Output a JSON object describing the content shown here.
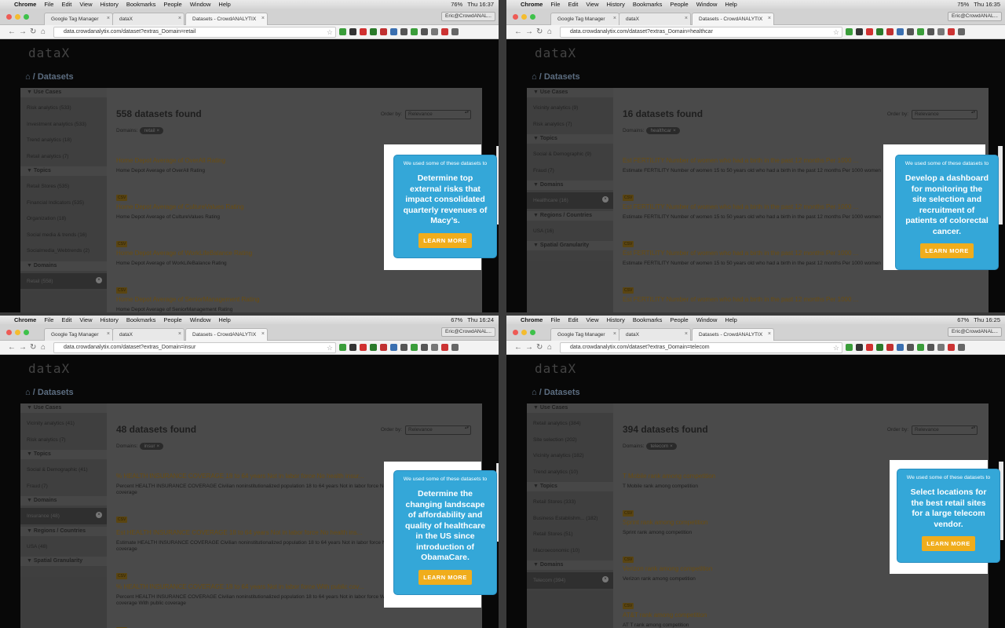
{
  "colors": {
    "card": "#34a7d8",
    "button": "#f0ad1c"
  },
  "quadrants": [
    {
      "menu": {
        "apple": "",
        "app": "Chrome",
        "items": [
          "File",
          "Edit",
          "View",
          "History",
          "Bookmarks",
          "People",
          "Window",
          "Help"
        ],
        "battery": "76%",
        "clock": "Thu 16:37"
      },
      "tabs": [
        "Google Tag Manager",
        "dataX",
        "Datasets - CrowdANALYTIX"
      ],
      "profile": "Eric@CrowdANAL...",
      "url": "data.crowdanalytix.com/dataset?extras_Domain=retail",
      "logo": "dataX",
      "breadcrumb": "/ Datasets",
      "sections": [
        {
          "title": "Use Cases",
          "items": [
            "Risk analytics (533)",
            "Investment analytics (533)",
            "Trend analytics (18)",
            "Retail analytics (7)"
          ]
        },
        {
          "title": "Topics",
          "items": [
            "Retail Stores (535)",
            "Financial Indicators (535)",
            "Organization (18)",
            "Social media & trends (16)",
            "Socialmedia_Webtrends (2)"
          ]
        },
        {
          "title": "Domains",
          "items": [
            "Retail (558)"
          ]
        }
      ],
      "found": "558 datasets found",
      "domains_label": "Domains:",
      "chip": "retail",
      "order_label": "Order by:",
      "order_value": "Relevance",
      "results": [
        {
          "title": "Home Depot Average of OverAll Rating",
          "desc": "Home Depot Average of OverAll Rating",
          "desc2": "",
          "badge": "CSV"
        },
        {
          "title": "Home Depot Average of CultureValues Rating",
          "desc": "Home Depot Average of CultureValues Rating",
          "desc2": "",
          "badge": "CSV"
        },
        {
          "title": "Home Depot Average of WorkLifeBalance Rating",
          "desc": "Home Depot Average of WorkLifeBalance Rating",
          "desc2": "",
          "badge": "CSV"
        },
        {
          "title": "Home Depot Average of SeniorManagement Rating",
          "desc": "Home Depot Average of SeniorManagement Rating",
          "desc2": "",
          "badge": ""
        }
      ],
      "card": {
        "lead": "We used some of these datasets to",
        "head": "Determine top external risks that impact consolidated quarterly revenues of Macy’s.",
        "button": "LEARN MORE"
      }
    },
    {
      "menu": {
        "apple": "",
        "app": "Chrome",
        "items": [
          "File",
          "Edit",
          "View",
          "History",
          "Bookmarks",
          "People",
          "Window",
          "Help"
        ],
        "battery": "75%",
        "clock": "Thu 16:35"
      },
      "tabs": [
        "Google Tag Manager",
        "dataX",
        "Datasets - CrowdANALYTIX"
      ],
      "profile": "Eric@CrowdANAL...",
      "url": "data.crowdanalytix.com/dataset?extras_Domain=healthcar",
      "logo": "dataX",
      "breadcrumb": "/ Datasets",
      "sections": [
        {
          "title": "Use Cases",
          "items": [
            "Vicinity analytics (9)",
            "Risk analytics (7)"
          ]
        },
        {
          "title": "Topics",
          "items": [
            "Social & Demographic (9)",
            "Fraud (7)"
          ]
        },
        {
          "title": "Domains",
          "items": [
            "Healthcare (16)"
          ]
        },
        {
          "title": "Regions / Countries",
          "items": [
            "USA (16)"
          ]
        },
        {
          "title": "Spatial Granularity",
          "items": []
        }
      ],
      "found": "16 datasets found",
      "domains_label": "Domains:",
      "chip": "healthcar",
      "order_label": "Order by:",
      "order_value": "Relevance",
      "results": [
        {
          "title": "Est FERTILITY Number of women who had a birth in the past 12 months Per 1000 ...",
          "desc": "Estimate FERTILITY Number of women 15 to 50 years old who had a birth in the past 12 months Per 1000 women",
          "desc2": "",
          "badge": "CSV"
        },
        {
          "title": "Est FERTILITY Number of women who had a birth in the past 12 months Per 1000 ...",
          "desc": "Estimate FERTILITY Number of women 15 to 50 years old who had a birth in the past 12 months Per 1000 women",
          "desc2": "",
          "badge": "CSV"
        },
        {
          "title": "Est FERTILITY Number of women who had a birth in the past 12 months Per 1000 ...",
          "desc": "Estimate FERTILITY Number of women 15 to 50 years old who had a birth in the past 12 months Per 1000 women",
          "desc2": "",
          "badge": "CSV"
        },
        {
          "title": "Est FERTILITY Number of women who had a birth in the past 12 months Per 1000 ...",
          "desc": "",
          "desc2": "",
          "badge": ""
        }
      ],
      "card": {
        "lead": "We used some of these datasets to",
        "head": "Develop a dashboard for monitoring the site selection and recruitment of patients of colorectal cancer.",
        "button": "LEARN MORE"
      }
    },
    {
      "menu": {
        "apple": "",
        "app": "Chrome",
        "items": [
          "File",
          "Edit",
          "View",
          "History",
          "Bookmarks",
          "People",
          "Window",
          "Help"
        ],
        "battery": "67%",
        "clock": "Thu 16:24"
      },
      "tabs": [
        "Google Tag Manager",
        "dataX",
        "Datasets - CrowdANALYTIX"
      ],
      "profile": "Eric@CrowdANAL...",
      "url": "data.crowdanalytix.com/dataset?extras_Domain=insur",
      "logo": "dataX",
      "breadcrumb": "/ Datasets",
      "sections": [
        {
          "title": "Use Cases",
          "items": [
            "Vicinity analytics (41)",
            "Risk analytics (7)"
          ]
        },
        {
          "title": "Topics",
          "items": [
            "Social & Demographic (41)",
            "Fraud (7)"
          ]
        },
        {
          "title": "Domains",
          "items": [
            "Insurance (48)"
          ]
        },
        {
          "title": "Regions / Countries",
          "items": [
            "USA (48)"
          ]
        },
        {
          "title": "Spatial Granularity",
          "items": []
        }
      ],
      "found": "48 datasets found",
      "domains_label": "Domains:",
      "chip": "insur",
      "order_label": "Order by:",
      "order_value": "Relevance",
      "results": [
        {
          "title": "% HEALTH INSURANCE COVERAGE 18 to 64 years Not in labor force No health insur...",
          "desc": "Percent HEALTH INSURANCE COVERAGE Civilian noninstitutionalized population 18 to 64 years Not in labor force No health insurance",
          "desc2": "coverage",
          "badge": "CSV"
        },
        {
          "title": "Est HEALTH INSURANCE COVERAGE 18 to 64 years Not in labor force No health ins...",
          "desc": "Estimate HEALTH INSURANCE COVERAGE Civilian noninstitutionalized population 18 to 64 years Not in labor force No health insurance",
          "desc2": "coverage",
          "badge": "CSV"
        },
        {
          "title": "% HEALTH INSURANCE COVERAGE 18 to 64 years Not in labor force With public cov...",
          "desc": "Percent HEALTH INSURANCE COVERAGE Civilian noninstitutionalized population 18 to 64 years Not in labor force With health insurance",
          "desc2": "coverage With public coverage",
          "badge": "CSV"
        }
      ],
      "card": {
        "lead": "We used some of these datasets to",
        "head": "Determine the changing landscape of affordability and quality of healthcare in the US since introduction of ObamaCare.",
        "button": "LEARN MORE"
      }
    },
    {
      "menu": {
        "apple": "",
        "app": "Chrome",
        "items": [
          "File",
          "Edit",
          "View",
          "History",
          "Bookmarks",
          "People",
          "Window",
          "Help"
        ],
        "battery": "67%",
        "clock": "Thu 16:25"
      },
      "tabs": [
        "Google Tag Manager",
        "dataX",
        "Datasets - CrowdANALYTIX"
      ],
      "profile": "Eric@CrowdANAL...",
      "url": "data.crowdanalytix.com/dataset?extras_Domain=telecom",
      "logo": "dataX",
      "breadcrumb": "/ Datasets",
      "sections": [
        {
          "title": "Use Cases",
          "items": [
            "Retail analytics (384)",
            "Site selection (202)",
            "Vicinity analytics (182)",
            "Trend analytics (10)"
          ]
        },
        {
          "title": "Topics",
          "items": [
            "Retail Stores (333)",
            "Business Establishm... (182)",
            "Retail Stores (51)",
            "Macroeconomic (10)"
          ]
        },
        {
          "title": "Domains",
          "items": [
            "Telecom (394)"
          ]
        }
      ],
      "found": "394 datasets found",
      "domains_label": "Domains:",
      "chip": "telecom",
      "order_label": "Order by:",
      "order_value": "Relevance",
      "results": [
        {
          "title": "T Mobile rank among competition",
          "desc": "T Mobile rank among competition",
          "desc2": "",
          "badge": "CSV"
        },
        {
          "title": "Sprint rank among competition",
          "desc": "Sprint rank among competition",
          "desc2": "",
          "badge": "CSV"
        },
        {
          "title": "Verizon rank among competition",
          "desc": "Verizon rank among competition",
          "desc2": "",
          "badge": "CSV"
        },
        {
          "title": "AT&T rank among competition",
          "desc": "AT T rank among competition",
          "desc2": "",
          "badge": ""
        }
      ],
      "card": {
        "lead": "We used some of these datasets to",
        "head": "Select locations for the best retail sites for a large telecom vendor.",
        "button": "LEARN MORE"
      }
    }
  ]
}
